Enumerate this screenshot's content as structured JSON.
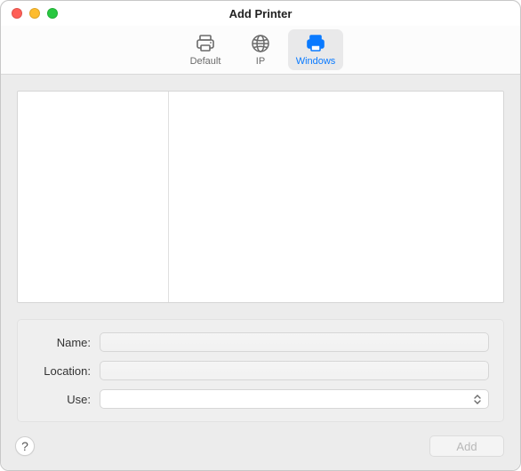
{
  "title": "Add Printer",
  "tabs": [
    {
      "id": "default",
      "label": "Default",
      "selected": false
    },
    {
      "id": "ip",
      "label": "IP",
      "selected": false
    },
    {
      "id": "windows",
      "label": "Windows",
      "selected": true
    }
  ],
  "form": {
    "name_label": "Name:",
    "name_value": "",
    "location_label": "Location:",
    "location_value": "",
    "use_label": "Use:",
    "use_value": ""
  },
  "footer": {
    "help_symbol": "?",
    "add_label": "Add",
    "add_enabled": false
  },
  "colors": {
    "accent": "#0a7aff",
    "bg_panel": "#ececec"
  }
}
